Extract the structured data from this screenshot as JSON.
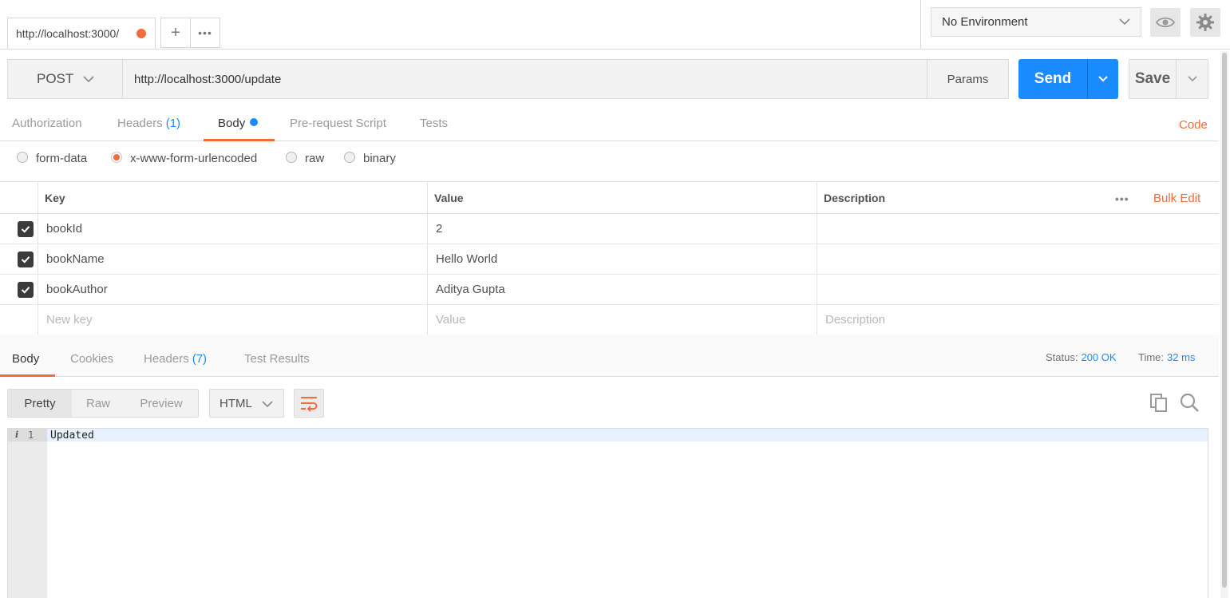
{
  "topbar": {
    "tab_url": "http://localhost:3000/",
    "add_label": "+",
    "more_label": "•••",
    "environment": "No Environment"
  },
  "request": {
    "method": "POST",
    "url": "http://localhost:3000/update",
    "params_label": "Params",
    "send_label": "Send",
    "save_label": "Save",
    "code_label": "Code"
  },
  "req_tabs": {
    "authorization": "Authorization",
    "headers": "Headers",
    "headers_count": "(1)",
    "body": "Body",
    "prerequest": "Pre-request Script",
    "tests": "Tests"
  },
  "body_types": {
    "form_data": "form-data",
    "urlencoded": "x-www-form-urlencoded",
    "raw": "raw",
    "binary": "binary",
    "selected": "x-www-form-urlencoded"
  },
  "kv_table": {
    "headers": {
      "key": "Key",
      "value": "Value",
      "description": "Description"
    },
    "more_label": "•••",
    "bulk_edit": "Bulk Edit",
    "rows": [
      {
        "key": "bookId",
        "value": "2",
        "checked": true
      },
      {
        "key": "bookName",
        "value": "Hello World",
        "checked": true
      },
      {
        "key": "bookAuthor",
        "value": "Aditya Gupta",
        "checked": true
      }
    ],
    "placeholders": {
      "key": "New key",
      "value": "Value",
      "description": "Description"
    }
  },
  "response": {
    "tabs": {
      "body": "Body",
      "cookies": "Cookies",
      "headers": "Headers",
      "headers_count": "(7)",
      "test_results": "Test Results"
    },
    "status_label": "Status:",
    "status_value": "200 OK",
    "time_label": "Time:",
    "time_value": "32 ms",
    "formats": {
      "pretty": "Pretty",
      "raw": "Raw",
      "preview": "Preview"
    },
    "language": "HTML",
    "line_number": "1",
    "info_glyph": "i",
    "body_text": "Updated"
  },
  "colors": {
    "accent": "#f26b3a",
    "primary": "#1a8cff"
  }
}
